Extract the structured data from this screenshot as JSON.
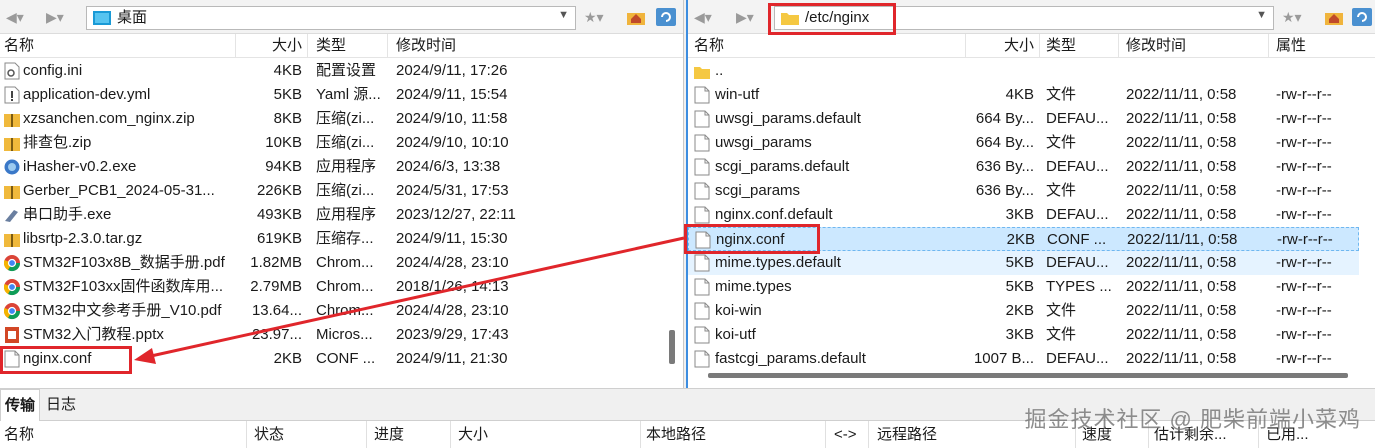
{
  "left": {
    "address": "桌面",
    "columns": [
      "名称",
      "大小",
      "类型",
      "修改时间"
    ],
    "files": [
      {
        "icon": "settings-file-icon",
        "name": "config.ini",
        "size": "4KB",
        "type": "配置设置",
        "date": "2024/9/11, 17:26"
      },
      {
        "icon": "yaml-file-icon",
        "name": "application-dev.yml",
        "size": "5KB",
        "type": "Yaml 源...",
        "date": "2024/9/11, 15:54"
      },
      {
        "icon": "zip-file-icon",
        "name": "xzsanchen.com_nginx.zip",
        "size": "8KB",
        "type": "压缩(zi...",
        "date": "2024/9/10, 11:58"
      },
      {
        "icon": "zip-file-icon",
        "name": "排查包.zip",
        "size": "10KB",
        "type": "压缩(zi...",
        "date": "2024/9/10, 10:10"
      },
      {
        "icon": "exe-file-icon",
        "name": "iHasher-v0.2.exe",
        "size": "94KB",
        "type": "应用程序",
        "date": "2024/6/3, 13:38"
      },
      {
        "icon": "zip-file-icon",
        "name": "Gerber_PCB1_2024-05-31...",
        "size": "226KB",
        "type": "压缩(zi...",
        "date": "2024/5/31, 17:53"
      },
      {
        "icon": "serial-tool-icon",
        "name": "串口助手.exe",
        "size": "493KB",
        "type": "应用程序",
        "date": "2023/12/27, 22:11"
      },
      {
        "icon": "zip-file-icon",
        "name": "libsrtp-2.3.0.tar.gz",
        "size": "619KB",
        "type": "压缩存...",
        "date": "2024/9/11, 15:30"
      },
      {
        "icon": "chrome-icon",
        "name": "STM32F103x8B_数据手册.pdf",
        "size": "1.82MB",
        "type": "Chrom...",
        "date": "2024/4/28, 23:10"
      },
      {
        "icon": "chrome-icon",
        "name": "STM32F103xx固件函数库用...",
        "size": "2.79MB",
        "type": "Chrom...",
        "date": "2018/1/26, 14:13"
      },
      {
        "icon": "chrome-icon",
        "name": "STM32中文参考手册_V10.pdf",
        "size": "13.64...",
        "type": "Chrom...",
        "date": "2024/4/28, 23:10"
      },
      {
        "icon": "pptx-file-icon",
        "name": "STM32入门教程.pptx",
        "size": "23.97...",
        "type": "Micros...",
        "date": "2023/9/29, 17:43"
      },
      {
        "icon": "file-icon",
        "name": "nginx.conf",
        "size": "2KB",
        "type": "CONF ...",
        "date": "2024/9/11, 21:30"
      }
    ]
  },
  "right": {
    "address": "/etc/nginx",
    "columns": [
      "名称",
      "大小",
      "类型",
      "修改时间",
      "属性"
    ],
    "files": [
      {
        "icon": "folder-icon",
        "name": "..",
        "size": "",
        "type": "",
        "date": "",
        "perm": ""
      },
      {
        "icon": "file-icon",
        "name": "win-utf",
        "size": "4KB",
        "type": "文件",
        "date": "2022/11/11, 0:58",
        "perm": "-rw-r--r--"
      },
      {
        "icon": "file-icon",
        "name": "uwsgi_params.default",
        "size": "664 By...",
        "type": "DEFAU...",
        "date": "2022/11/11, 0:58",
        "perm": "-rw-r--r--"
      },
      {
        "icon": "file-icon",
        "name": "uwsgi_params",
        "size": "664 By...",
        "type": "文件",
        "date": "2022/11/11, 0:58",
        "perm": "-rw-r--r--"
      },
      {
        "icon": "file-icon",
        "name": "scgi_params.default",
        "size": "636 By...",
        "type": "DEFAU...",
        "date": "2022/11/11, 0:58",
        "perm": "-rw-r--r--"
      },
      {
        "icon": "file-icon",
        "name": "scgi_params",
        "size": "636 By...",
        "type": "文件",
        "date": "2022/11/11, 0:58",
        "perm": "-rw-r--r--"
      },
      {
        "icon": "file-icon",
        "name": "nginx.conf.default",
        "size": "3KB",
        "type": "DEFAU...",
        "date": "2022/11/11, 0:58",
        "perm": "-rw-r--r--"
      },
      {
        "icon": "file-icon",
        "name": "nginx.conf",
        "size": "2KB",
        "type": "CONF ...",
        "date": "2022/11/11, 0:58",
        "perm": "-rw-r--r--"
      },
      {
        "icon": "file-icon",
        "name": "mime.types.default",
        "size": "5KB",
        "type": "DEFAU...",
        "date": "2022/11/11, 0:58",
        "perm": "-rw-r--r--"
      },
      {
        "icon": "file-icon",
        "name": "mime.types",
        "size": "5KB",
        "type": "TYPES ...",
        "date": "2022/11/11, 0:58",
        "perm": "-rw-r--r--"
      },
      {
        "icon": "file-icon",
        "name": "koi-win",
        "size": "2KB",
        "type": "文件",
        "date": "2022/11/11, 0:58",
        "perm": "-rw-r--r--"
      },
      {
        "icon": "file-icon",
        "name": "koi-utf",
        "size": "3KB",
        "type": "文件",
        "date": "2022/11/11, 0:58",
        "perm": "-rw-r--r--"
      },
      {
        "icon": "file-icon",
        "name": "fastcgi_params.default",
        "size": "1007 B...",
        "type": "DEFAU...",
        "date": "2022/11/11, 0:58",
        "perm": "-rw-r--r--"
      }
    ]
  },
  "bottom": {
    "tabs": [
      "传输",
      "日志"
    ],
    "columns": [
      "名称",
      "状态",
      "进度",
      "大小",
      "本地路径",
      "<->",
      "远程路径",
      "速度",
      "估计剩余...",
      "已用..."
    ]
  },
  "watermark": "掘金技术社区 @ 肥柴前端小菜鸡",
  "colors": {
    "annotation": "#e0262b",
    "selection": "#cce8ff",
    "accent": "#3c8de0"
  }
}
